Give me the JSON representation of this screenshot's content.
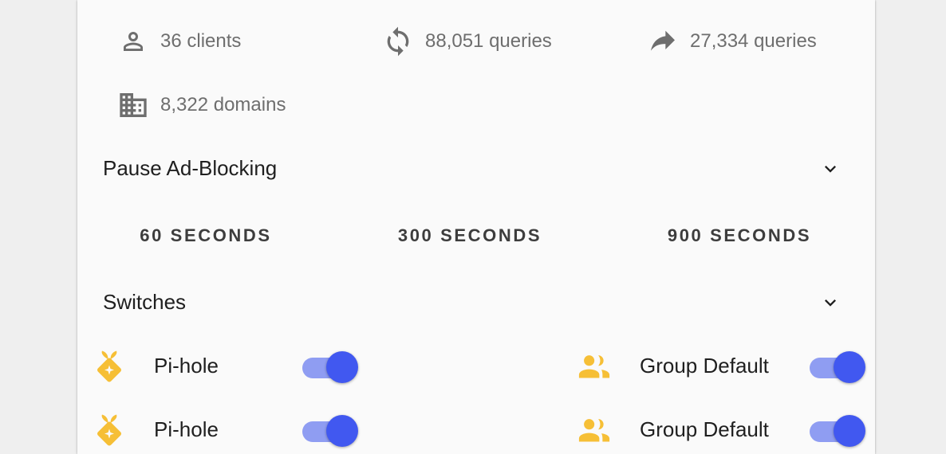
{
  "stats": {
    "clients": "36 clients",
    "total_queries": "88,051 queries",
    "forwarded_queries": "27,334 queries",
    "domains": "8,322 domains"
  },
  "pause": {
    "title": "Pause Ad-Blocking",
    "buttons": [
      "60 SECONDS",
      "300 SECONDS",
      "900 SECONDS"
    ]
  },
  "switches": {
    "title": "Switches",
    "items": [
      {
        "label": "Pi-hole",
        "icon": "pihole-icon",
        "on": true
      },
      {
        "label": "Group Default",
        "icon": "group-icon",
        "on": true
      },
      {
        "label": "Pi-hole",
        "icon": "pihole-icon",
        "on": true
      },
      {
        "label": "Group Default",
        "icon": "group-icon",
        "on": true
      }
    ]
  },
  "colors": {
    "accent": "#4158f0",
    "track": "#8f9df2",
    "icon_yellow": "#f6bf36",
    "stat_text": "#6e6e6e"
  }
}
